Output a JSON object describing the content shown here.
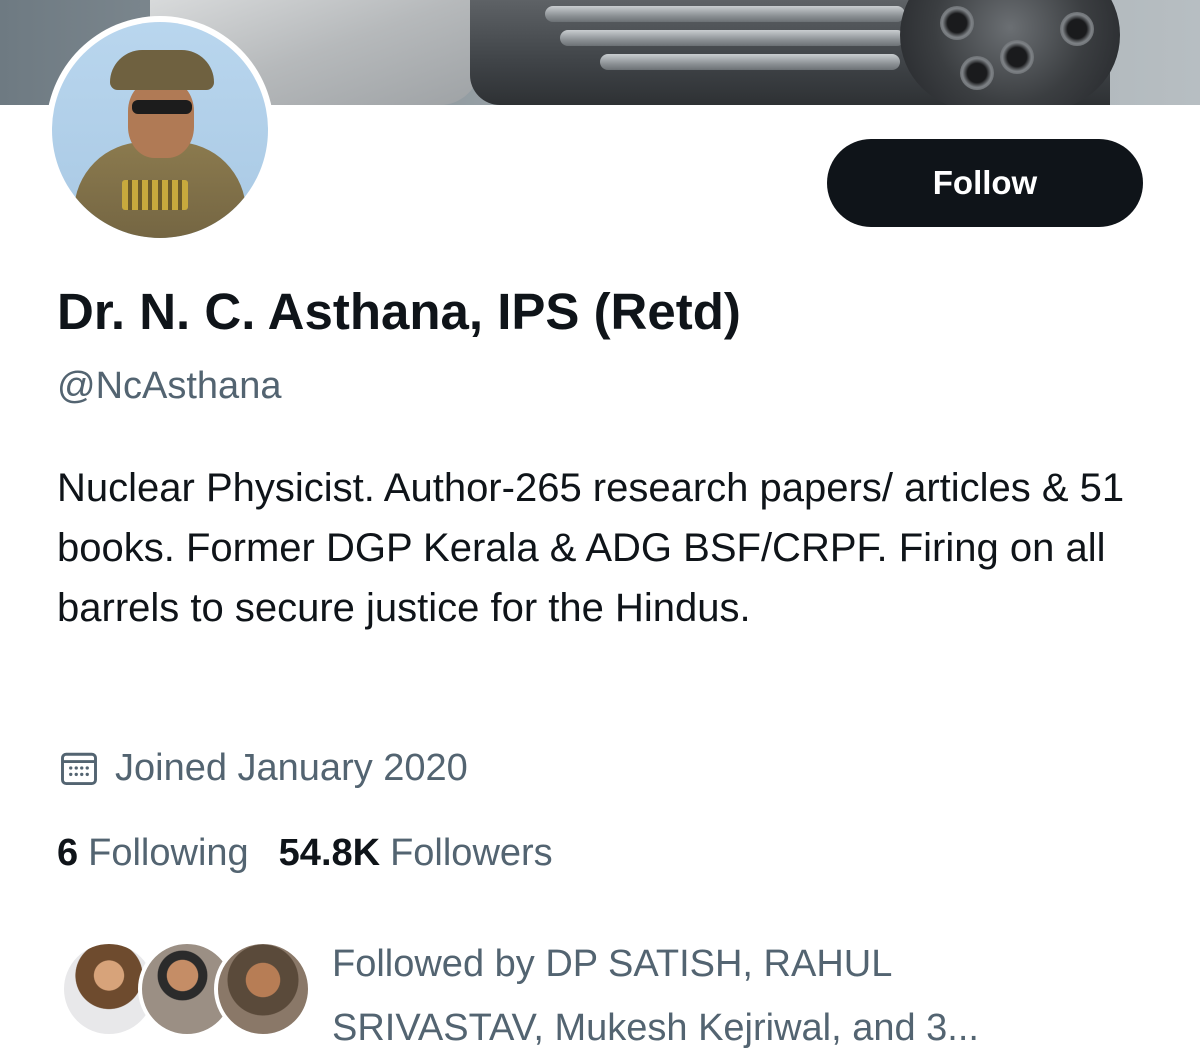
{
  "profile": {
    "display_name": "Dr. N. C. Asthana, IPS (Retd)",
    "handle": "@NcAsthana",
    "bio": "Nuclear Physicist. Author-265 research papers/ articles & 51 books. Former DGP Kerala & ADG BSF/CRPF. Firing on all barrels to secure justice for the Hindus.",
    "joined": "Joined January 2020"
  },
  "actions": {
    "follow_label": "Follow"
  },
  "stats": {
    "following_count": "6",
    "following_label": "Following",
    "followers_count": "54.8K",
    "followers_label": "Followers"
  },
  "followed_by": {
    "text": "Followed by DP SATISH, RAHUL SRIVASTAV, Mukesh Kejriwal, and 3..."
  },
  "icons": {
    "calendar": "calendar-icon"
  },
  "colors": {
    "primary_text": "#0f1419",
    "secondary_text": "#536471",
    "button_bg": "#0f1419",
    "button_text": "#ffffff"
  }
}
